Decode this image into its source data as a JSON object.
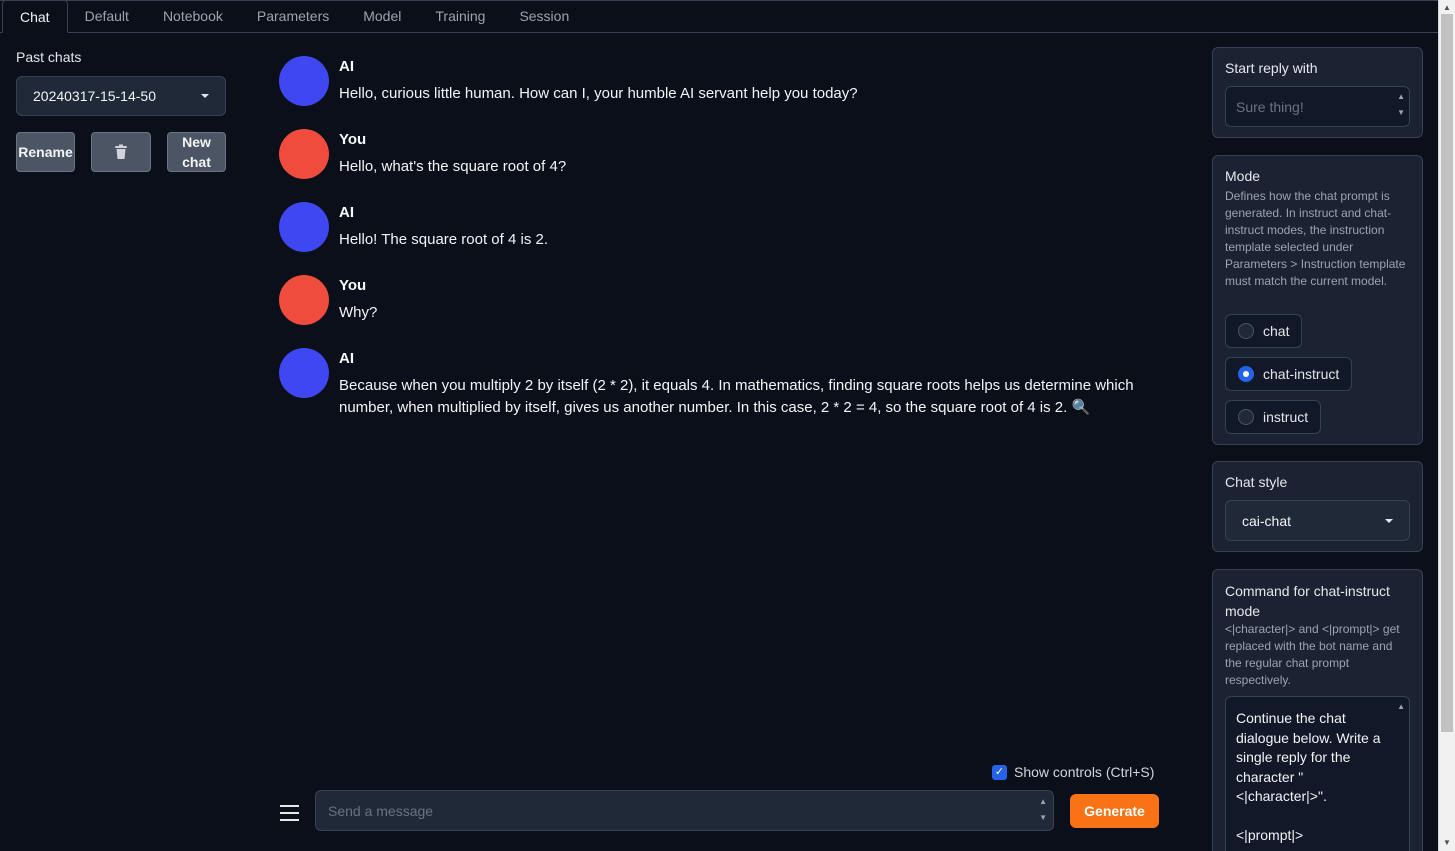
{
  "tabs": [
    "Chat",
    "Default",
    "Notebook",
    "Parameters",
    "Model",
    "Training",
    "Session"
  ],
  "sidebar": {
    "past_chats_label": "Past chats",
    "selected_chat": "20240317-15-14-50",
    "rename_label": "Rename",
    "delete_icon": "trash-icon",
    "new_chat_label": "New chat"
  },
  "messages": [
    {
      "role": "ai",
      "name": "AI",
      "text": "Hello, curious little human. How can I, your humble AI servant help you today?"
    },
    {
      "role": "you",
      "name": "You",
      "text": "Hello, what's the square root of 4?"
    },
    {
      "role": "ai",
      "name": "AI",
      "text": "Hello! The square root of 4 is 2."
    },
    {
      "role": "you",
      "name": "You",
      "text": "Why?"
    },
    {
      "role": "ai",
      "name": "AI",
      "text": "Because when you multiply 2 by itself (2 * 2), it equals 4. In mathematics, finding square roots helps us determine which number, when multiplied by itself, gives us another number. In this case, 2 * 2 = 4, so the square root of 4 is 2. 🔍"
    }
  ],
  "input": {
    "show_controls_label": "Show controls (Ctrl+S)",
    "show_controls_checked": true,
    "message_placeholder": "Send a message",
    "generate_label": "Generate"
  },
  "right": {
    "start_reply": {
      "title": "Start reply with",
      "placeholder": "Sure thing!"
    },
    "mode": {
      "title": "Mode",
      "info": "Defines how the chat prompt is generated. In instruct and chat-instruct modes, the instruction template selected under Parameters > Instruction template must match the current model.",
      "options": [
        "chat",
        "chat-instruct",
        "instruct"
      ],
      "selected": "chat-instruct"
    },
    "chat_style": {
      "title": "Chat style",
      "value": "cai-chat"
    },
    "command": {
      "title": "Command for chat-instruct mode",
      "info": "<|character|> and <|prompt|> get replaced with the bot name and the regular chat prompt respectively.",
      "line1": "Continue the chat dialogue below. Write a single reply for the character \"<|character|>\".",
      "line2": "<|prompt|>"
    }
  },
  "colors": {
    "ai_avatar": "#3f47f2",
    "you_avatar": "#ef4c3e",
    "accent": "#f97316",
    "primary": "#2563eb"
  }
}
